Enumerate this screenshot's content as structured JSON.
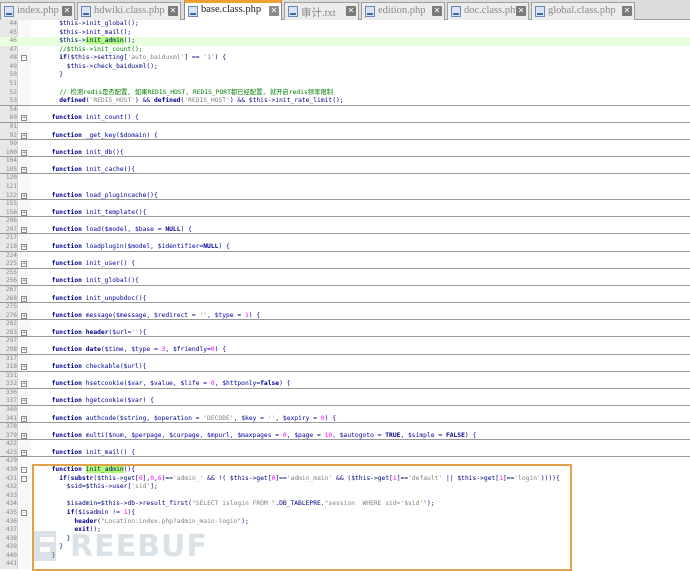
{
  "tabs": [
    {
      "label": "index.php",
      "active": false
    },
    {
      "label": "hdwiki.class.php",
      "active": false
    },
    {
      "label": "base.class.php",
      "active": true
    },
    {
      "label": "审计.txt",
      "active": false
    },
    {
      "label": "edition.php",
      "active": false
    },
    {
      "label": "doc.class.php",
      "active": false
    },
    {
      "label": "global.class.php",
      "active": false
    }
  ],
  "lines": [
    {
      "n": "44",
      "indent": 4,
      "sep": false,
      "fold": "",
      "parts": [
        [
          "tx",
          "$this->init_global();"
        ]
      ]
    },
    {
      "n": "45",
      "indent": 4,
      "sep": false,
      "fold": "",
      "parts": [
        [
          "tx",
          "$this->init_mail();"
        ]
      ]
    },
    {
      "n": "46",
      "indent": 4,
      "sep": false,
      "fold": "",
      "hl": true,
      "parts": [
        [
          "tx",
          "$this->"
        ],
        [
          "mark",
          "init_admin"
        ],
        [
          "tx",
          "();"
        ]
      ]
    },
    {
      "n": "47",
      "indent": 4,
      "sep": false,
      "fold": "",
      "parts": [
        [
          "cm",
          "//$this->init_count();"
        ]
      ]
    },
    {
      "n": "48",
      "indent": 4,
      "sep": false,
      "fold": "-",
      "parts": [
        [
          "kw",
          "if"
        ],
        [
          "tx",
          "($this->setting["
        ],
        [
          "st",
          "'auto_baiduxml'"
        ],
        [
          "tx",
          "] == "
        ],
        [
          "st",
          "'1'"
        ],
        [
          "tx",
          ") {"
        ]
      ]
    },
    {
      "n": "49",
      "indent": 6,
      "sep": false,
      "fold": "",
      "parts": [
        [
          "tx",
          "$this->check_baiduxml();"
        ]
      ]
    },
    {
      "n": "50",
      "indent": 4,
      "sep": false,
      "fold": "",
      "parts": [
        [
          "tx",
          "}"
        ]
      ]
    },
    {
      "n": "51",
      "indent": 0,
      "sep": false,
      "fold": "",
      "parts": []
    },
    {
      "n": "52",
      "indent": 4,
      "sep": false,
      "fold": "",
      "parts": [
        [
          "cm",
          "// 检测redis是否配置, 如果REDIS_HOST, REDIS_PORT都已经配置, 就开启redis频率限制"
        ]
      ]
    },
    {
      "n": "53",
      "indent": 4,
      "sep": true,
      "fold": "",
      "parts": [
        [
          "kw",
          "defined"
        ],
        [
          "tx",
          "("
        ],
        [
          "st",
          "'REDIS_HOST'"
        ],
        [
          "tx",
          ") && "
        ],
        [
          "kw",
          "defined"
        ],
        [
          "tx",
          "("
        ],
        [
          "st",
          "'REDIS_HOST'"
        ],
        [
          "tx",
          ") && $this->init_rate_limit();"
        ]
      ]
    },
    {
      "n": "54",
      "indent": 0,
      "sep": false,
      "fold": "",
      "parts": []
    },
    {
      "n": "60",
      "indent": 2,
      "sep": true,
      "fold": "+",
      "parts": [
        [
          "kw",
          "function"
        ],
        [
          "fn",
          " init_count() {"
        ]
      ]
    },
    {
      "n": "91",
      "indent": 0,
      "sep": false,
      "fold": "",
      "parts": []
    },
    {
      "n": "92",
      "indent": 2,
      "sep": true,
      "fold": "+",
      "parts": [
        [
          "kw",
          "function"
        ],
        [
          "fn",
          " _get_key($domain) {"
        ]
      ]
    },
    {
      "n": "99",
      "indent": 0,
      "sep": false,
      "fold": "",
      "parts": []
    },
    {
      "n": "100",
      "indent": 2,
      "sep": true,
      "fold": "+",
      "parts": [
        [
          "kw",
          "function"
        ],
        [
          "fn",
          " init_db(){"
        ]
      ]
    },
    {
      "n": "104",
      "indent": 0,
      "sep": false,
      "fold": "",
      "parts": []
    },
    {
      "n": "105",
      "indent": 2,
      "sep": true,
      "fold": "+",
      "parts": [
        [
          "kw",
          "function"
        ],
        [
          "fn",
          " init_cache(){"
        ]
      ]
    },
    {
      "n": "120",
      "indent": 0,
      "sep": false,
      "fold": "",
      "parts": []
    },
    {
      "n": "121",
      "indent": 0,
      "sep": false,
      "fold": "",
      "parts": []
    },
    {
      "n": "122",
      "indent": 2,
      "sep": true,
      "fold": "+",
      "parts": [
        [
          "kw",
          "function"
        ],
        [
          "fn",
          " load_plugincache(){"
        ]
      ]
    },
    {
      "n": "155",
      "indent": 0,
      "sep": false,
      "fold": "",
      "parts": []
    },
    {
      "n": "156",
      "indent": 2,
      "sep": true,
      "fold": "+",
      "parts": [
        [
          "kw",
          "function"
        ],
        [
          "fn",
          " init_template(){"
        ]
      ]
    },
    {
      "n": "206",
      "indent": 0,
      "sep": false,
      "fold": "",
      "parts": []
    },
    {
      "n": "207",
      "indent": 2,
      "sep": true,
      "fold": "+",
      "parts": [
        [
          "kw",
          "function"
        ],
        [
          "fn",
          " load($model, $base = "
        ],
        [
          "kw",
          "NULL"
        ],
        [
          "fn",
          ") {"
        ]
      ]
    },
    {
      "n": "217",
      "indent": 0,
      "sep": false,
      "fold": "",
      "parts": []
    },
    {
      "n": "218",
      "indent": 2,
      "sep": true,
      "fold": "+",
      "parts": [
        [
          "kw",
          "function"
        ],
        [
          "fn",
          " loadplugin($model, $identifier="
        ],
        [
          "kw",
          "NULL"
        ],
        [
          "fn",
          ") {"
        ]
      ]
    },
    {
      "n": "224",
      "indent": 0,
      "sep": false,
      "fold": "",
      "parts": []
    },
    {
      "n": "225",
      "indent": 2,
      "sep": true,
      "fold": "+",
      "parts": [
        [
          "kw",
          "function"
        ],
        [
          "fn",
          " init_user() {"
        ]
      ]
    },
    {
      "n": "255",
      "indent": 0,
      "sep": false,
      "fold": "",
      "parts": []
    },
    {
      "n": "256",
      "indent": 2,
      "sep": true,
      "fold": "+",
      "parts": [
        [
          "kw",
          "function"
        ],
        [
          "fn",
          " init_global(){"
        ]
      ]
    },
    {
      "n": "267",
      "indent": 0,
      "sep": false,
      "fold": "",
      "parts": []
    },
    {
      "n": "268",
      "indent": 2,
      "sep": true,
      "fold": "+",
      "parts": [
        [
          "kw",
          "function"
        ],
        [
          "fn",
          " init_unpubdoc(){"
        ]
      ]
    },
    {
      "n": "275",
      "indent": 0,
      "sep": false,
      "fold": "",
      "parts": []
    },
    {
      "n": "276",
      "indent": 2,
      "sep": true,
      "fold": "+",
      "parts": [
        [
          "kw",
          "function"
        ],
        [
          "fn",
          " message($message, $redirect = "
        ],
        [
          "st",
          "''"
        ],
        [
          "fn",
          ", $type = "
        ],
        [
          "nm",
          "1"
        ],
        [
          "fn",
          ") {"
        ]
      ]
    },
    {
      "n": "282",
      "indent": 0,
      "sep": false,
      "fold": "",
      "parts": []
    },
    {
      "n": "283",
      "indent": 2,
      "sep": true,
      "fold": "+",
      "parts": [
        [
          "kw",
          "function"
        ],
        [
          "fn",
          " "
        ],
        [
          "kw",
          "header"
        ],
        [
          "fn",
          "($url="
        ],
        [
          "st",
          "''"
        ],
        [
          "fn",
          "){"
        ]
      ]
    },
    {
      "n": "297",
      "indent": 0,
      "sep": false,
      "fold": "",
      "parts": []
    },
    {
      "n": "298",
      "indent": 2,
      "sep": true,
      "fold": "+",
      "parts": [
        [
          "kw",
          "function"
        ],
        [
          "fn",
          " "
        ],
        [
          "kw",
          "date"
        ],
        [
          "fn",
          "($time, $type = "
        ],
        [
          "nm",
          "3"
        ],
        [
          "fn",
          ", $friendly="
        ],
        [
          "nm",
          "0"
        ],
        [
          "fn",
          ") {"
        ]
      ]
    },
    {
      "n": "317",
      "indent": 0,
      "sep": false,
      "fold": "",
      "parts": []
    },
    {
      "n": "318",
      "indent": 2,
      "sep": true,
      "fold": "+",
      "parts": [
        [
          "kw",
          "function"
        ],
        [
          "fn",
          " checkable($url){"
        ]
      ]
    },
    {
      "n": "331",
      "indent": 0,
      "sep": false,
      "fold": "",
      "parts": []
    },
    {
      "n": "332",
      "indent": 2,
      "sep": true,
      "fold": "+",
      "parts": [
        [
          "kw",
          "function"
        ],
        [
          "fn",
          " hsetcookie($var, $value, $life = "
        ],
        [
          "nm",
          "0"
        ],
        [
          "fn",
          ", $httponly="
        ],
        [
          "kw",
          "false"
        ],
        [
          "fn",
          ") {"
        ]
      ]
    },
    {
      "n": "336",
      "indent": 0,
      "sep": false,
      "fold": "",
      "parts": []
    },
    {
      "n": "337",
      "indent": 2,
      "sep": true,
      "fold": "+",
      "parts": [
        [
          "kw",
          "function"
        ],
        [
          "fn",
          " hgetcookie($var) {"
        ]
      ]
    },
    {
      "n": "340",
      "indent": 0,
      "sep": false,
      "fold": "",
      "parts": []
    },
    {
      "n": "341",
      "indent": 2,
      "sep": true,
      "fold": "+",
      "parts": [
        [
          "kw",
          "function"
        ],
        [
          "fn",
          " authcode($string, $operation = "
        ],
        [
          "st",
          "'DECODE'"
        ],
        [
          "fn",
          ", $key = "
        ],
        [
          "st",
          "''"
        ],
        [
          "fn",
          ", $expiry = "
        ],
        [
          "nm",
          "0"
        ],
        [
          "fn",
          ") {"
        ]
      ]
    },
    {
      "n": "378",
      "indent": 0,
      "sep": false,
      "fold": "",
      "parts": []
    },
    {
      "n": "379",
      "indent": 2,
      "sep": true,
      "fold": "+",
      "parts": [
        [
          "kw",
          "function"
        ],
        [
          "fn",
          " multi($num, $perpage, $curpage, $mpurl, $maxpages = "
        ],
        [
          "nm",
          "0"
        ],
        [
          "fn",
          ", $page = "
        ],
        [
          "nm",
          "10"
        ],
        [
          "fn",
          ", $autogoto = "
        ],
        [
          "kw",
          "TRUE"
        ],
        [
          "fn",
          ", $simple = "
        ],
        [
          "kw",
          "FALSE"
        ],
        [
          "fn",
          ") {"
        ]
      ]
    },
    {
      "n": "422",
      "indent": 0,
      "sep": false,
      "fold": "",
      "parts": []
    },
    {
      "n": "423",
      "indent": 2,
      "sep": true,
      "fold": "+",
      "parts": [
        [
          "kw",
          "function"
        ],
        [
          "fn",
          " init_mail() {"
        ]
      ]
    },
    {
      "n": "429",
      "indent": 0,
      "sep": false,
      "fold": "",
      "parts": []
    },
    {
      "n": "430",
      "indent": 2,
      "sep": false,
      "fold": "-",
      "parts": [
        [
          "kw",
          "function"
        ],
        [
          "fn",
          " "
        ],
        [
          "mark",
          "init_admin"
        ],
        [
          "fn",
          "(){"
        ]
      ]
    },
    {
      "n": "431",
      "indent": 4,
      "sep": false,
      "fold": "-",
      "parts": [
        [
          "kw",
          "if"
        ],
        [
          "tx",
          "("
        ],
        [
          "kw",
          "substr"
        ],
        [
          "tx",
          "($this->get["
        ],
        [
          "nm",
          "0"
        ],
        [
          "tx",
          "],"
        ],
        [
          "nm",
          "0"
        ],
        [
          "tx",
          ","
        ],
        [
          "nm",
          "6"
        ],
        [
          "tx",
          ")=="
        ],
        [
          "st",
          "'admin_'"
        ],
        [
          "tx",
          " && !( $this->get["
        ],
        [
          "nm",
          "0"
        ],
        [
          "tx",
          "]=="
        ],
        [
          "st",
          "'admin_main'"
        ],
        [
          "tx",
          " && ($this->get["
        ],
        [
          "nm",
          "1"
        ],
        [
          "tx",
          "]=="
        ],
        [
          "st",
          "'default'"
        ],
        [
          "tx",
          " || $this->get["
        ],
        [
          "nm",
          "1"
        ],
        [
          "tx",
          "]=="
        ],
        [
          "st",
          "'login'"
        ],
        [
          "tx",
          ")))){"
        ]
      ]
    },
    {
      "n": "432",
      "indent": 6,
      "sep": false,
      "fold": "",
      "parts": [
        [
          "tx",
          "$sid=$this->user["
        ],
        [
          "st",
          "'sid'"
        ],
        [
          "tx",
          "];"
        ]
      ]
    },
    {
      "n": "433",
      "indent": 0,
      "sep": false,
      "fold": "",
      "parts": []
    },
    {
      "n": "434",
      "indent": 6,
      "sep": false,
      "fold": "",
      "parts": [
        [
          "tx",
          "$isadmin=$this->db->result_first("
        ],
        [
          "st",
          "\"SELECT islogin FROM \""
        ],
        [
          "tx",
          ".DB_TABLEPRE."
        ],
        [
          "st",
          "\"session  WHERE sid='$sid'\""
        ],
        [
          "tx",
          ");"
        ]
      ]
    },
    {
      "n": "435",
      "indent": 6,
      "sep": false,
      "fold": "-",
      "parts": [
        [
          "kw",
          "if"
        ],
        [
          "tx",
          "($isadmin != "
        ],
        [
          "nm",
          "1"
        ],
        [
          "tx",
          "){"
        ]
      ]
    },
    {
      "n": "436",
      "indent": 8,
      "sep": false,
      "fold": "",
      "parts": [
        [
          "kw",
          "header"
        ],
        [
          "tx",
          "("
        ],
        [
          "st",
          "\"Location:index.php?admin_main-login\""
        ],
        [
          "tx",
          ");"
        ]
      ]
    },
    {
      "n": "437",
      "indent": 8,
      "sep": false,
      "fold": "",
      "parts": [
        [
          "kw",
          "exit"
        ],
        [
          "tx",
          "();"
        ]
      ]
    },
    {
      "n": "438",
      "indent": 6,
      "sep": false,
      "fold": "",
      "parts": [
        [
          "tx",
          "}"
        ]
      ]
    },
    {
      "n": "439",
      "indent": 4,
      "sep": false,
      "fold": "",
      "parts": [
        [
          "tx",
          "}"
        ]
      ]
    },
    {
      "n": "440",
      "indent": 2,
      "sep": false,
      "fold": "",
      "parts": [
        [
          "tx",
          "}"
        ]
      ]
    },
    {
      "n": "441",
      "indent": 0,
      "sep": false,
      "fold": "",
      "parts": []
    }
  ],
  "watermark": "REEBUF"
}
